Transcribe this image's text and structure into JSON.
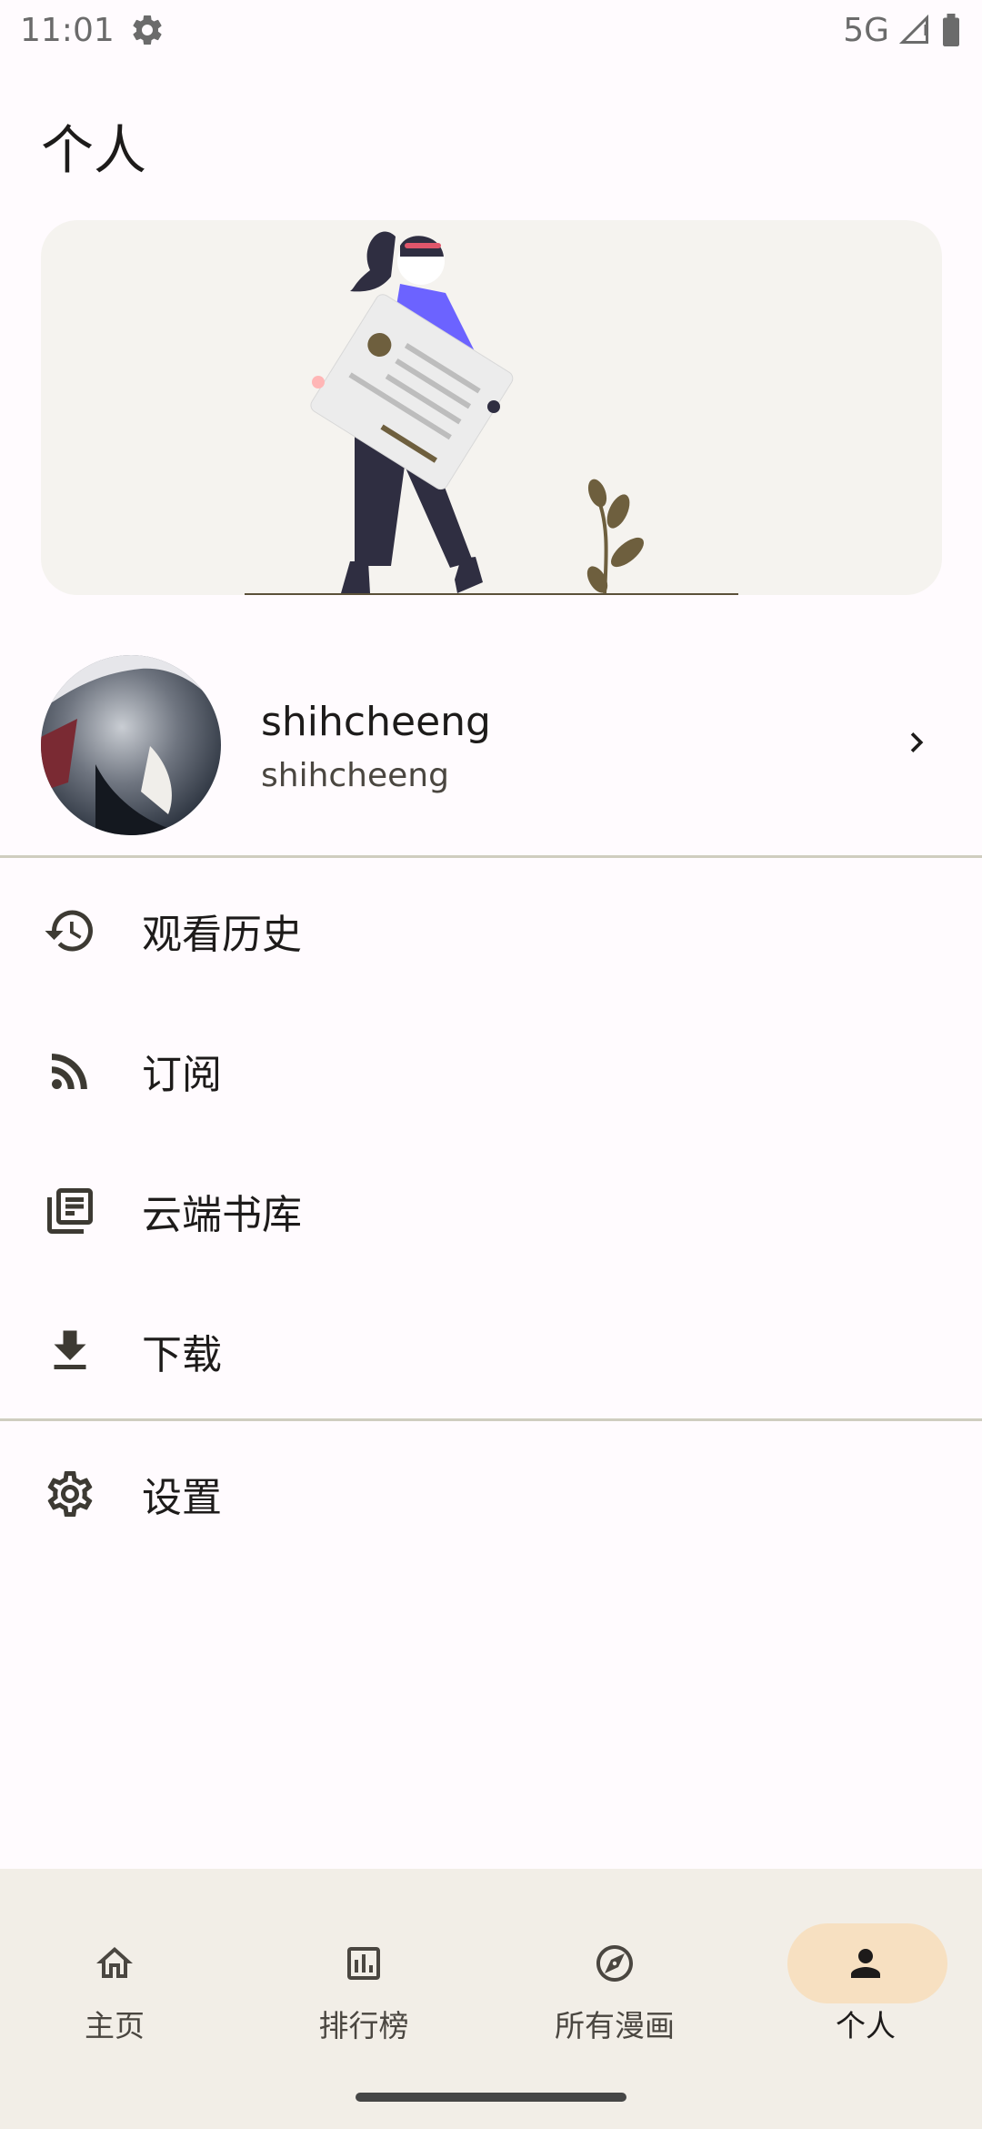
{
  "status_bar": {
    "time": "11:01",
    "network": "5G",
    "icons": [
      "settings-gear-icon",
      "signal-icon",
      "battery-icon"
    ]
  },
  "page": {
    "title": "个人"
  },
  "profile": {
    "name": "shihcheeng",
    "subtitle": "shihcheeng"
  },
  "menu": {
    "items": [
      {
        "label": "观看历史",
        "icon": "history-icon"
      },
      {
        "label": "订阅",
        "icon": "rss-icon"
      },
      {
        "label": "云端书库",
        "icon": "library-icon"
      },
      {
        "label": "下载",
        "icon": "download-icon"
      }
    ],
    "settings": {
      "label": "设置",
      "icon": "settings-icon"
    }
  },
  "bottom_nav": {
    "items": [
      {
        "label": "主页",
        "icon": "home-icon"
      },
      {
        "label": "排行榜",
        "icon": "leaderboard-icon"
      },
      {
        "label": "所有漫画",
        "icon": "compass-icon"
      },
      {
        "label": "个人",
        "icon": "person-icon"
      }
    ],
    "active_index": 3
  },
  "colors": {
    "background": "#fffbfe",
    "hero_background": "#f5f3ef",
    "nav_background": "#f2eee7",
    "nav_active_pill": "#f7e0c1",
    "divider": "#cfcdbf",
    "text_primary": "#1d1b1a"
  }
}
